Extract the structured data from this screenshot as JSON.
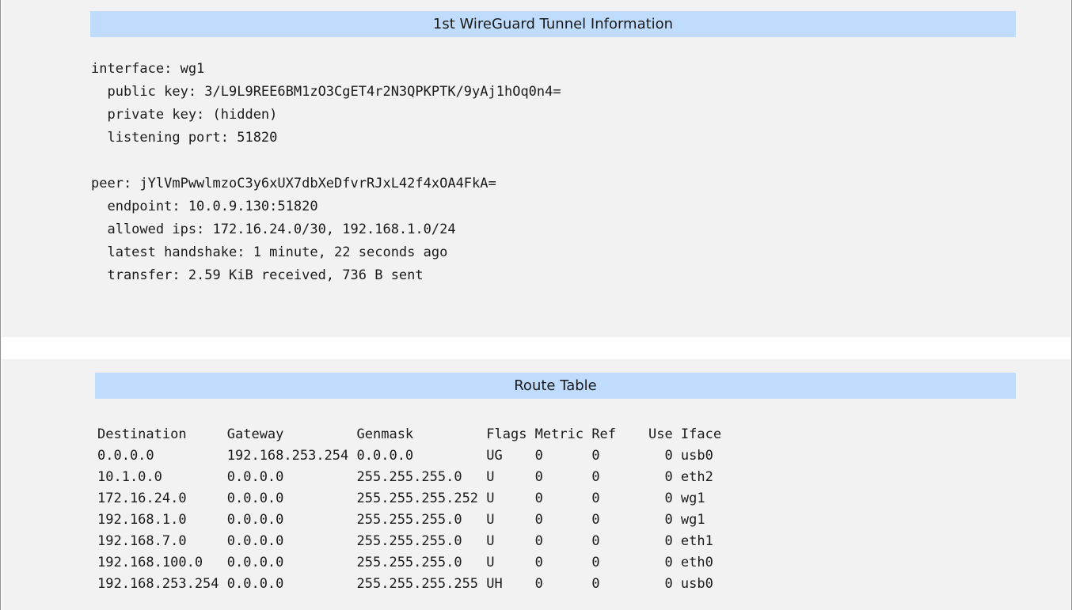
{
  "wireguard": {
    "title": "1st WireGuard Tunnel Information",
    "output": "interface: wg1\n  public key: 3/L9L9REE6BM1zO3CgET4r2N3QPKPTK/9yAj1hOq0n4=\n  private key: (hidden)\n  listening port: 51820\n\npeer: jYlVmPwwlmzoC3y6xUX7dbXeDfvrRJxL42f4xOA4FkA=\n  endpoint: 10.0.9.130:51820\n  allowed ips: 172.16.24.0/30, 192.168.1.0/24\n  latest handshake: 1 minute, 22 seconds ago\n  transfer: 2.59 KiB received, 736 B sent"
  },
  "route_table": {
    "title": "Route Table",
    "output": "Destination     Gateway         Genmask         Flags Metric Ref    Use Iface\n0.0.0.0         192.168.253.254 0.0.0.0         UG    0      0        0 usb0\n10.1.0.0        0.0.0.0         255.255.255.0   U     0      0        0 eth2\n172.16.24.0     0.0.0.0         255.255.255.252 U     0      0        0 wg1\n192.168.1.0     0.0.0.0         255.255.255.0   U     0      0        0 wg1\n192.168.7.0     0.0.0.0         255.255.255.0   U     0      0        0 eth1\n192.168.100.0   0.0.0.0         255.255.255.0   U     0      0        0 eth0\n192.168.253.254 0.0.0.0         255.255.255.255 UH    0      0        0 usb0"
  }
}
